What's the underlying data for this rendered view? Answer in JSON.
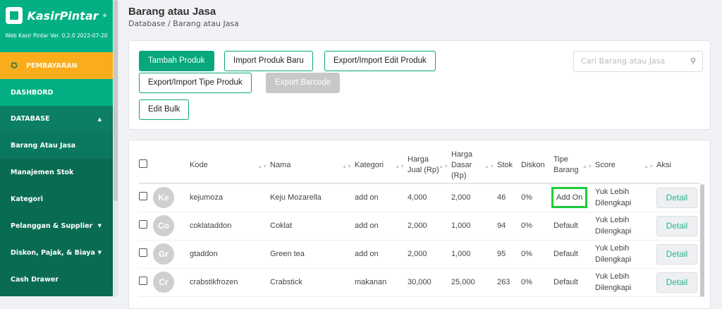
{
  "sidebar": {
    "brand": "KasirPintar",
    "version": "Web Kasir Pintar Ver. 0.2.0 2022-07-20",
    "items": [
      {
        "label": "PEMBAYARAN"
      },
      {
        "label": "DASHBORD"
      },
      {
        "label": "DATABASE"
      },
      {
        "label": "Barang Atau Jasa"
      },
      {
        "label": "Manajemen Stok"
      },
      {
        "label": "Kategori"
      },
      {
        "label": "Pelanggan & Supplier"
      },
      {
        "label": "Diskon, Pajak, & Biaya"
      },
      {
        "label": "Cash Drawer"
      }
    ]
  },
  "header": {
    "title": "Barang atau Jasa",
    "breadcrumb": "Database / Barang atau Jasa"
  },
  "toolbar": {
    "tambah": "Tambah Produk",
    "import": "Import Produk Baru",
    "export_edit": "Export/Import Edit Produk",
    "export_tipe": "Export/Import Tipe Produk",
    "export_barcode": "Export Barcode",
    "edit_bulk": "Edit Bulk",
    "search_placeholder": "Cari Barang atau Jasa"
  },
  "table": {
    "headers": {
      "kode": "Kode",
      "nama": "Nama",
      "kategori": "Kategori",
      "jual1": "Harga",
      "jual2": "Jual (Rp)",
      "dasar1": "Harga",
      "dasar2": "Dasar",
      "dasar3": "(Rp)",
      "stok": "Stok",
      "diskon": "Diskon",
      "tipe1": "Tipe",
      "tipe2": "Barang",
      "score": "Score",
      "aksi": "Aksi"
    },
    "rows": [
      {
        "initials": "Ke",
        "kode": "kejumoza",
        "nama": "Keju Mozarella",
        "kategori": "add on",
        "jual": "4,000",
        "dasar": "2,000",
        "stok": "46",
        "diskon": "0%",
        "tipe": "Add On",
        "score1": "Yuk Lebih",
        "score2": "Dilengkapi",
        "aksi": "Detail"
      },
      {
        "initials": "Co",
        "kode": "coklataddon",
        "nama": "Coklat",
        "kategori": "add on",
        "jual": "2,000",
        "dasar": "1,000",
        "stok": "94",
        "diskon": "0%",
        "tipe": "Default",
        "score1": "Yuk Lebih",
        "score2": "Dilengkapi",
        "aksi": "Detail"
      },
      {
        "initials": "Gr",
        "kode": "gtaddon",
        "nama": "Green tea",
        "kategori": "add on",
        "jual": "2,000",
        "dasar": "1,000",
        "stok": "95",
        "diskon": "0%",
        "tipe": "Default",
        "score1": "Yuk Lebih",
        "score2": "Dilengkapi",
        "aksi": "Detail"
      },
      {
        "initials": "Cr",
        "kode": "crabstikfrozen",
        "nama": "Crabstick",
        "kategori": "makanan",
        "jual": "30,000",
        "dasar": "25,000",
        "stok": "263",
        "diskon": "0%",
        "tipe": "Default",
        "score1": "Yuk Lebih",
        "score2": "Dilengkapi",
        "aksi": "Detail"
      }
    ]
  }
}
